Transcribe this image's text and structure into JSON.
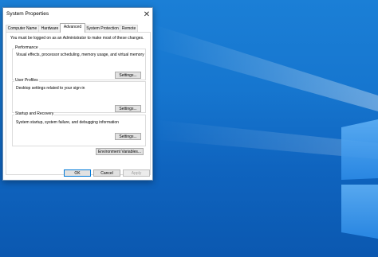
{
  "window": {
    "title": "System Properties"
  },
  "tabs": [
    {
      "label": "Computer Name"
    },
    {
      "label": "Hardware"
    },
    {
      "label": "Advanced"
    },
    {
      "label": "System Protection"
    },
    {
      "label": "Remote"
    }
  ],
  "advanced": {
    "admin_note": "You must be logged on as an Administrator to make most of these changes.",
    "performance": {
      "title": "Performance",
      "description": "Visual effects, processor scheduling, memory usage, and virtual memory",
      "button": "Settings..."
    },
    "user_profiles": {
      "title": "User Profiles",
      "description": "Desktop settings related to your sign-in",
      "button": "Settings..."
    },
    "startup_recovery": {
      "title": "Startup and Recovery",
      "description": "System startup, system failure, and debugging information",
      "button": "Settings..."
    },
    "env_button": "Environment Variables..."
  },
  "footer": {
    "ok": "OK",
    "cancel": "Cancel",
    "apply": "Apply"
  }
}
